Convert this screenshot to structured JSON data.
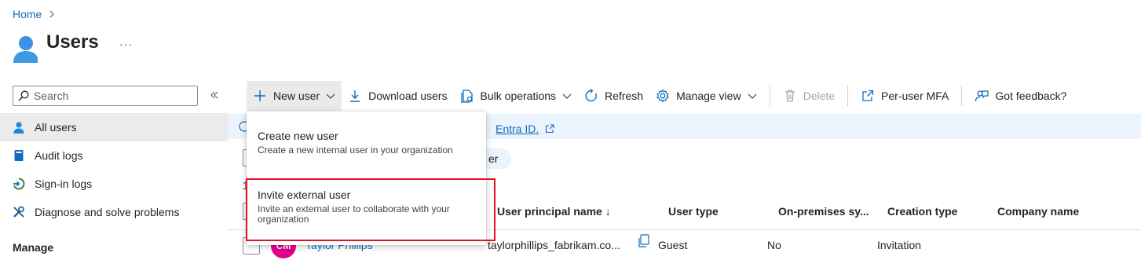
{
  "breadcrumb": {
    "home": "Home"
  },
  "header": {
    "title": "Users",
    "more": "···"
  },
  "sidebar": {
    "search_placeholder": "Search",
    "items": [
      {
        "label": "All users",
        "icon": "user-icon"
      },
      {
        "label": "Audit logs",
        "icon": "book-icon"
      },
      {
        "label": "Sign-in logs",
        "icon": "sign-in-icon"
      },
      {
        "label": "Diagnose and solve problems",
        "icon": "wrench-icon"
      }
    ],
    "section": "Manage"
  },
  "toolbar": {
    "new_user": "New user",
    "download_users": "Download users",
    "bulk_operations": "Bulk operations",
    "refresh": "Refresh",
    "manage_view": "Manage view",
    "delete": "Delete",
    "per_user_mfa": "Per-user MFA",
    "got_feedback": "Got feedback?"
  },
  "info": {
    "link_text": "Entra ID."
  },
  "filter": {
    "chip_fragment": "er",
    "count_fragment": "1"
  },
  "table": {
    "columns": [
      "User principal name ↓",
      "User type",
      "On-premises sy...",
      "Creation type",
      "Company name"
    ],
    "rows": [
      {
        "initials": "CM",
        "name": "Taylor Phillips",
        "upn": "taylorphillips_fabrikam.co...",
        "user_type": "Guest",
        "on_prem": "No",
        "creation_type": "Invitation",
        "company": ""
      }
    ]
  },
  "menu": {
    "items": [
      {
        "title": "Create new user",
        "desc": "Create a new internal user in your organization"
      },
      {
        "title": "Invite external user",
        "desc": "Invite an external user to collaborate with your organization"
      }
    ]
  },
  "colors": {
    "accent": "#0f6cbd",
    "avatar": "#e3008c",
    "highlight": "#e81123",
    "info_bar": "#ebf3fc"
  }
}
